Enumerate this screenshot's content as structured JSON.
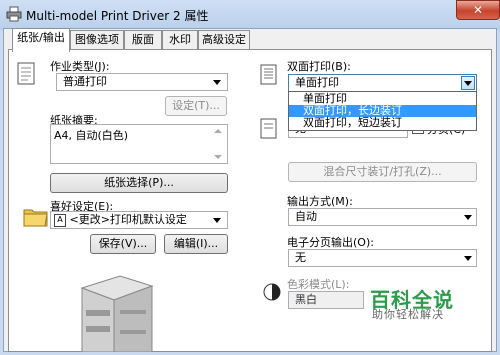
{
  "window": {
    "title": "Multi-model Print Driver 2 属性",
    "close_glyph": "✕"
  },
  "tabs": [
    {
      "label": "纸张/输出",
      "active": true
    },
    {
      "label": "图像选项"
    },
    {
      "label": "版面"
    },
    {
      "label": "水印"
    },
    {
      "label": "高级设定"
    }
  ],
  "left": {
    "job_type_label": "作业类型(J):",
    "job_type_value": "普通打印",
    "setup_button": "设定(T)...",
    "paper_summary_label": "纸张摘要:",
    "paper_summary_value": "A4, 自动(白色)",
    "paper_select_button": "纸张选择(P)...",
    "favorites_label": "喜好设定(E):",
    "favorites_value": "<更改>打印机默认设定",
    "favorites_badge": "A",
    "save_button": "保存(V)...",
    "edit_button": "编辑(I)..."
  },
  "right": {
    "duplex_label": "双面打印(B):",
    "duplex_value": "单面打印",
    "duplex_options": [
      "单面打印",
      "双面打印，长边装订",
      "双面打印，短边装订"
    ],
    "duplex_highlighted_index": 1,
    "collate_partial": "无",
    "collate_button_partial": "分页(C)",
    "mixed_size_button": "混合尺寸装订/打孔(Z)...",
    "output_label": "输出方式(M):",
    "output_value": "自动",
    "ecollate_label": "电子分页输出(O):",
    "ecollate_value": "无",
    "color_mode_label": "色彩模式(L):",
    "color_mode_value": "黑白"
  },
  "watermark": {
    "title": "百科全说",
    "subtitle": "助你轻松解决"
  },
  "colors": {
    "highlight": "#3399ff",
    "watermark_green": "#2a9d4a"
  }
}
